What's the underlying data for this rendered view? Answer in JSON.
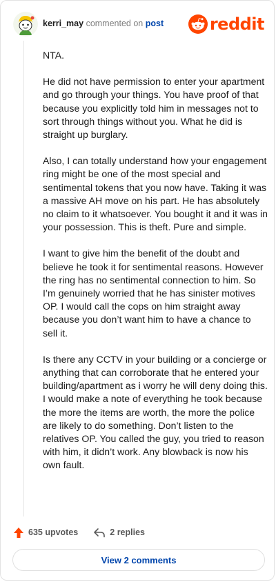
{
  "comment": {
    "username": "kerri_may",
    "action_text": "commented on",
    "target_link": "post",
    "paragraphs": [
      "NTA.",
      "He did not have permission to enter your apartment and go through your things. You have proof of that because you explicitly told him in messages not to sort through things without you. What he did is straight up burglary.",
      "Also, I can totally understand how your engagement ring might be one of the most special and sentimental tokens that you now have. Taking it was a massive AH move on his part. He has absolutely no claim to it whatsoever. You bought it and it was in your possession. This is theft. Pure and simple.",
      "I want to give him the benefit of the doubt and believe he took it for sentimental reasons. However the ring has no sentimental connection to him. So I’m genuinely worried that he has sinister motives OP. I would call the cops on him straight away because you don’t want him to have a chance to sell it.",
      "Is there any CCTV in your building or a concierge or anything that can corroborate that he entered your building/apartment as i worry he will deny doing this. I would make a note of everything he took because the more the items are worth, the more the police are likely to do something. Don’t listen to the relatives OP. You called the guy, you tried to reason with him, it didn’t work. Any blowback is now his own fault."
    ]
  },
  "brand": {
    "logo_text": "reddit",
    "color": "#ff4500"
  },
  "actions": {
    "upvotes": "635 upvotes",
    "replies": "2 replies"
  },
  "view_comments_label": "View 2 comments",
  "colors": {
    "upvote": "#ff4500",
    "link": "#0045ac"
  }
}
